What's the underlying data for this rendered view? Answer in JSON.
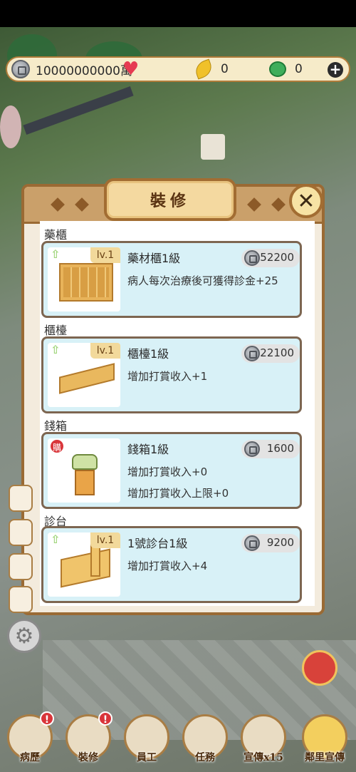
{
  "resources": {
    "silver": "10000000000萬",
    "leaves": "0",
    "jade": "0"
  },
  "modal": {
    "title": "裝修",
    "close_label": "✕",
    "sections": [
      {
        "title": "藥櫃",
        "level": "lv.1",
        "item_name": "藥材櫃1級",
        "cost": "52200",
        "desc": [
          "病人每次治療後可獲得診金+25"
        ]
      },
      {
        "title": "櫃檯",
        "level": "lv.1",
        "item_name": "櫃檯1級",
        "cost": "22100",
        "desc": [
          "增加打賞收入+1"
        ]
      },
      {
        "title": "錢箱",
        "level": "",
        "badge": "購",
        "item_name": "錢箱1級",
        "cost": "1600",
        "desc": [
          "增加打賞收入+0",
          "增加打賞收入上限+0"
        ]
      },
      {
        "title": "診台",
        "level": "lv.1",
        "item_name": "1號診台1級",
        "cost": "9200",
        "desc": [
          "增加打賞收入+4"
        ]
      }
    ]
  },
  "bottom_nav": [
    {
      "label": "病歷"
    },
    {
      "label": "裝修"
    },
    {
      "label": "員工"
    },
    {
      "label": "任務"
    },
    {
      "label": "宣傳x15"
    },
    {
      "label": "鄰里宣傳"
    }
  ],
  "colors": {
    "accent": "#a26d32",
    "card_bg": "#d8f1f7",
    "badge_red": "#d9353a"
  }
}
